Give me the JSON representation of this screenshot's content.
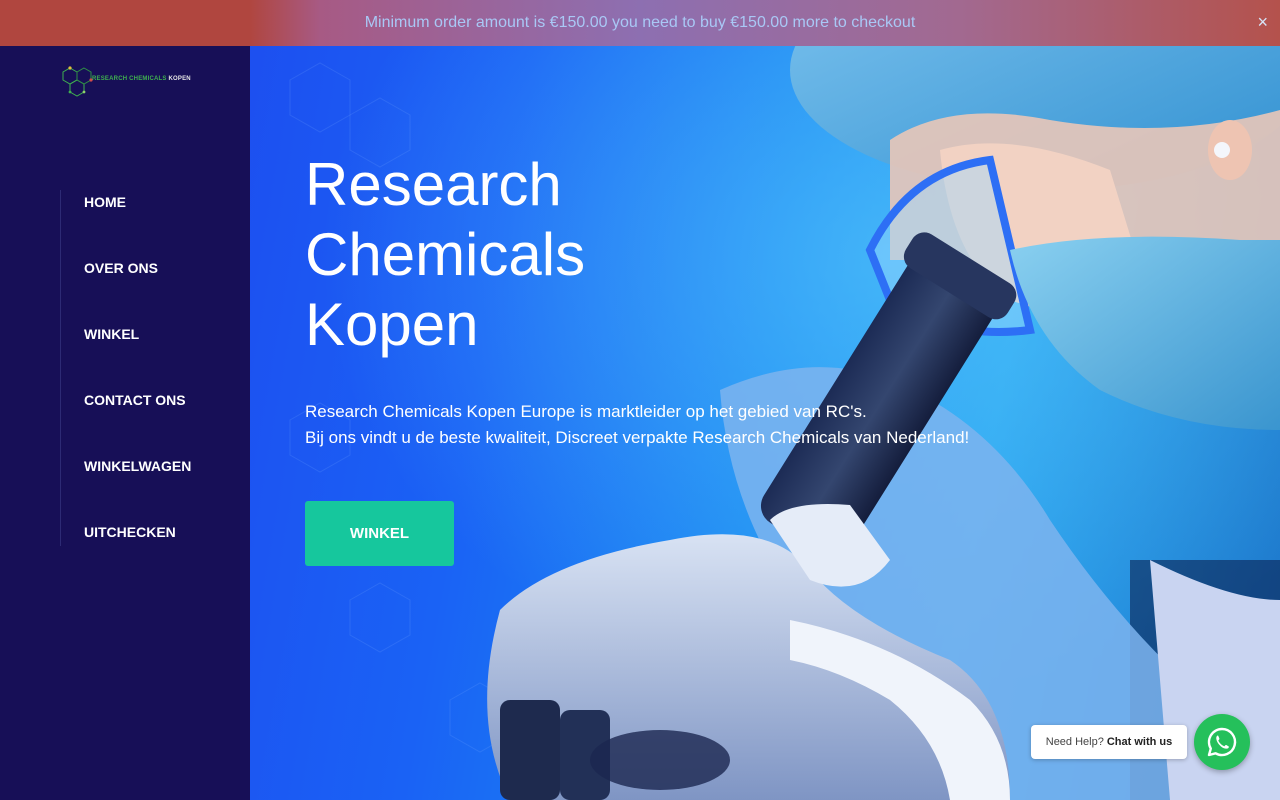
{
  "notice": {
    "message": "Minimum order amount is €150.00 you need to buy €150.00 more to checkout",
    "close_label": "×"
  },
  "logo": {
    "text_green": "RESEARCH CHEMICALS",
    "text_white": "KOPEN",
    "icon": "molecule-icon"
  },
  "nav": {
    "items": [
      {
        "label": "HOME"
      },
      {
        "label": "OVER ONS"
      },
      {
        "label": "WINKEL"
      },
      {
        "label": "CONTACT ONS"
      },
      {
        "label": "WINKELWAGEN"
      },
      {
        "label": "UITCHECKEN"
      }
    ]
  },
  "hero": {
    "title_lines": [
      "Research",
      "Chemicals",
      "Kopen"
    ],
    "description_lines": [
      "Research Chemicals Kopen Europe is marktleider op het gebied van RC's.",
      "Bij ons vindt u de beste kwaliteit, Discreet verpakte Research Chemicals van Nederland!"
    ],
    "button_label": "WINKEL"
  },
  "chat": {
    "prompt": "Need Help?",
    "action": "Chat with us",
    "icon": "whatsapp-icon"
  },
  "colors": {
    "sidebar_bg": "#170f57",
    "accent_button": "#16c79d",
    "whatsapp_green": "#25c05b"
  }
}
